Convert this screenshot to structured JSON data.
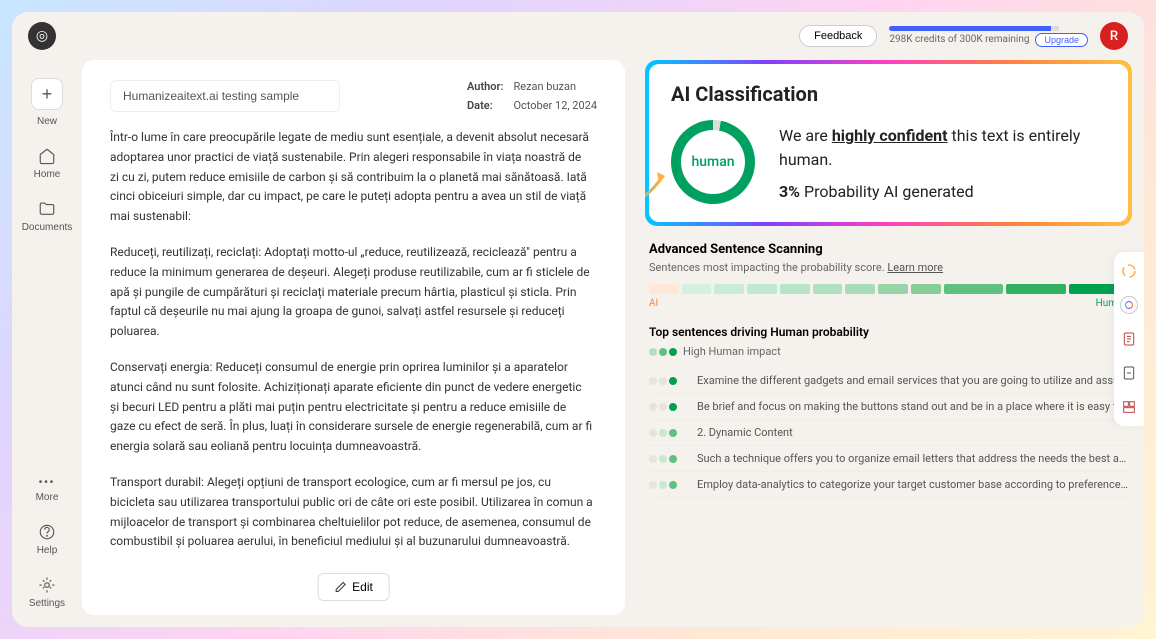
{
  "topbar": {
    "feedback": "Feedback",
    "credits": "298K credits of 300K remaining",
    "upgrade": "Upgrade",
    "avatar": "R"
  },
  "sidebar": {
    "new": "New",
    "home": "Home",
    "documents": "Documents",
    "more": "More",
    "help": "Help",
    "settings": "Settings"
  },
  "doc": {
    "title": "Humanizeaitext.ai testing sample",
    "author_label": "Author:",
    "author": "Rezan buzan",
    "date_label": "Date:",
    "date": "October 12, 2024",
    "p1": "Într-o lume în care preocupările legate de mediu sunt esențiale, a devenit absolut necesară adoptarea unor practici de viață sustenabile. Prin alegeri responsabile în viața noastră de zi cu zi, putem reduce emisiile de carbon și să contribuim la o planetă mai sănătoasă. Iată cinci obiceiuri simple, dar cu impact, pe care le puteți adopta pentru a avea un stil de viață mai sustenabil:",
    "p2": "Reduceți, reutilizați, reciclați: Adoptați motto-ul „reduce, reutilizează, reciclează\" pentru a reduce la minimum generarea de deșeuri. Alegeți produse reutilizabile, cum ar fi sticlele de apă și pungile de cumpărături și reciclați materiale precum hârtia, plasticul și sticla. Prin faptul că deșeurile nu mai ajung la groapa de gunoi, salvați astfel resursele și reduceți poluarea.",
    "p3": "Conservați energia: Reduceți consumul de energie prin oprirea luminilor și a aparatelor atunci când nu sunt folosite. Achiziționați aparate eficiente din punct de vedere energetic și becuri LED pentru a plăti mai puțin pentru electricitate și pentru a reduce emisiile de gaze cu efect de seră. În plus, luați în considerare sursele de energie regenerabilă, cum ar fi energia solară sau eoliană pentru locuința dumneavoastră.",
    "p4": "Transport durabil: Alegeți opțiuni de transport ecologice, cum ar fi mersul pe jos, cu bicicleta sau utilizarea transportului public ori de câte ori este posibil. Utilizarea în comun a mijloacelor de transport și combinarea cheltuielilor pot reduce, de asemenea, consumul de combustibil și poluarea aerului, în beneficiul mediului și al buzunarului dumneavoastră.",
    "edit": "Edit"
  },
  "classification": {
    "title": "AI Classification",
    "gauge_label": "human",
    "line1_pre": "We are ",
    "line1_hl": "highly confident",
    "line1_post": " this text is entirely human.",
    "prob_pct": "3%",
    "prob_text": " Probability AI generated"
  },
  "advanced": {
    "title": "Advanced Sentence Scanning",
    "sub": "Sentences most impacting the probability score. ",
    "learn": "Learn more",
    "ai_label": "AI",
    "human_label": "Human",
    "spectrum_colors": [
      "#ffe8d8",
      "#d4f0e0",
      "#c8ecd8",
      "#c0e8d0",
      "#b8e4c8",
      "#b0e0c0",
      "#a8dcb8",
      "#98d4a8",
      "#88cc98",
      "#60c080",
      "#30b060",
      "#00a050"
    ],
    "top_title": "Top sentences driving Human probability",
    "impact_label": "High Human impact",
    "sentences": [
      "Examine the different gadgets and email services that you are going to utilize and assure that...",
      "Be brief and focus on making the buttons stand out and be in a place where it is easy for the...",
      "2. Dynamic Content",
      "Such a technique offers you to organize email letters that address the needs the best and,...",
      "Employ data-analytics to categorize your target customer base according to preferences,..."
    ]
  }
}
